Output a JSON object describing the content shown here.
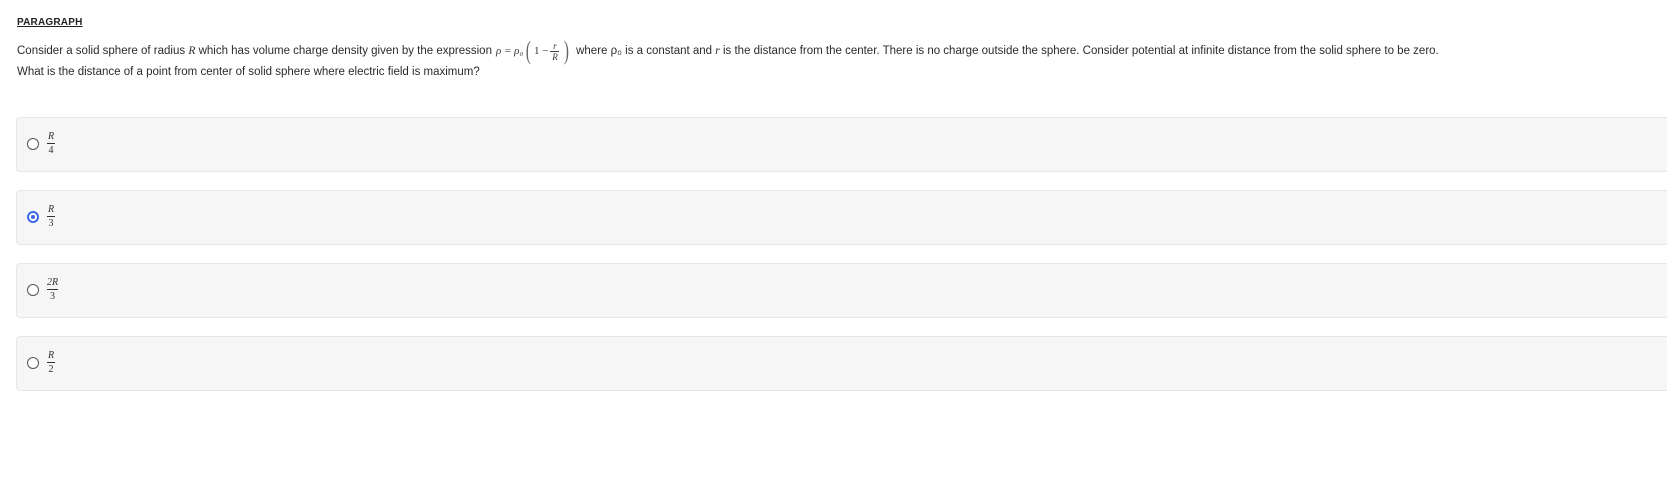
{
  "paragraph": {
    "heading": "PARAGRAPH"
  },
  "question": {
    "text_part1": "Consider a solid sphere of radius",
    "var_R": "R",
    "text_part2": "which has volume charge density given by the expression",
    "expr_lhs": "ρ = ρ₀",
    "expr_one_minus": "1 −",
    "expr_frac_num": "r",
    "expr_frac_den": "R",
    "text_part3": "where ρ₀ is a constant and",
    "var_r": "r",
    "text_part4": "is the distance from the center. There is no charge outside the sphere. Consider potential at infinite distance from the solid sphere to be zero.",
    "line2": "What is the distance of a point from center of solid sphere where electric field is maximum?"
  },
  "options": [
    {
      "num": "R",
      "den": "4",
      "selected": false
    },
    {
      "num": "R",
      "den": "3",
      "selected": true
    },
    {
      "num": "2R",
      "den": "3",
      "selected": false
    },
    {
      "num": "R",
      "den": "2",
      "selected": false
    }
  ],
  "colors": {
    "accent": "#3b68e8",
    "option_bg": "#f6f6f6",
    "option_border": "#e6e6e6"
  }
}
